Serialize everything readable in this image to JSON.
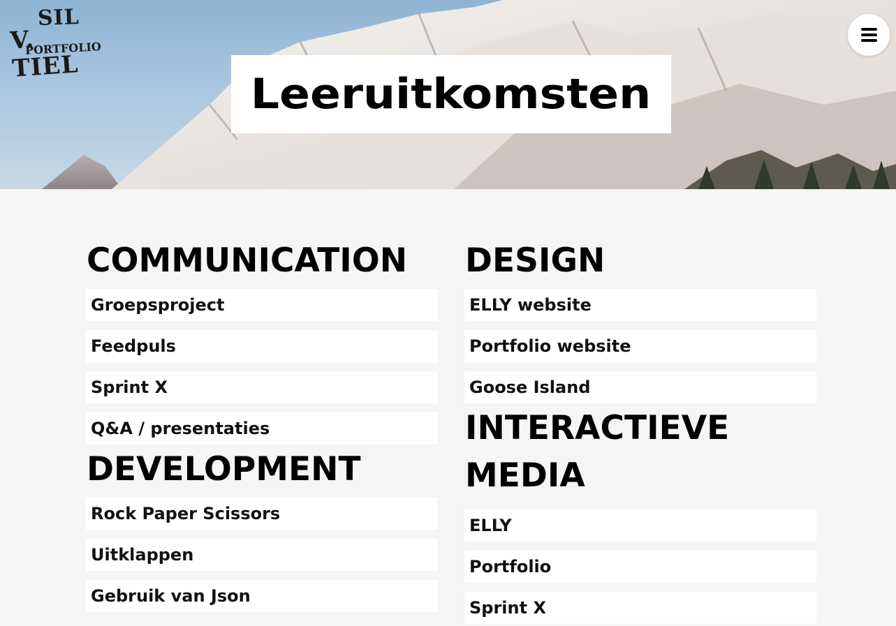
{
  "logo": {
    "line1": "SIL",
    "line2": "V. TIEL",
    "line3": "PORTFOLIO"
  },
  "menu": {
    "icon": "hamburger-icon"
  },
  "page": {
    "title": "Leeruitkomsten"
  },
  "sections": {
    "communication": {
      "heading": "COMMUNICATION",
      "items": [
        "Groepsproject",
        "Feedpuls",
        "Sprint X",
        "Q&A / presentaties"
      ]
    },
    "development": {
      "heading": "DEVELOPMENT",
      "items": [
        "Rock Paper Scissors",
        "Uitklappen",
        "Gebruik van Json"
      ]
    },
    "design": {
      "heading": "DESIGN",
      "items": [
        "ELLY website",
        "Portfolio website",
        "Goose Island"
      ]
    },
    "interactieve_media": {
      "heading_line1": "INTERACTIEVE",
      "heading_line2": "MEDIA",
      "items": [
        "ELLY",
        "Portfolio",
        "Sprint X"
      ]
    }
  },
  "colors": {
    "background": "#f5f5f5",
    "card": "#ffffff",
    "text": "#000000",
    "sky": "#9dbcd8"
  }
}
